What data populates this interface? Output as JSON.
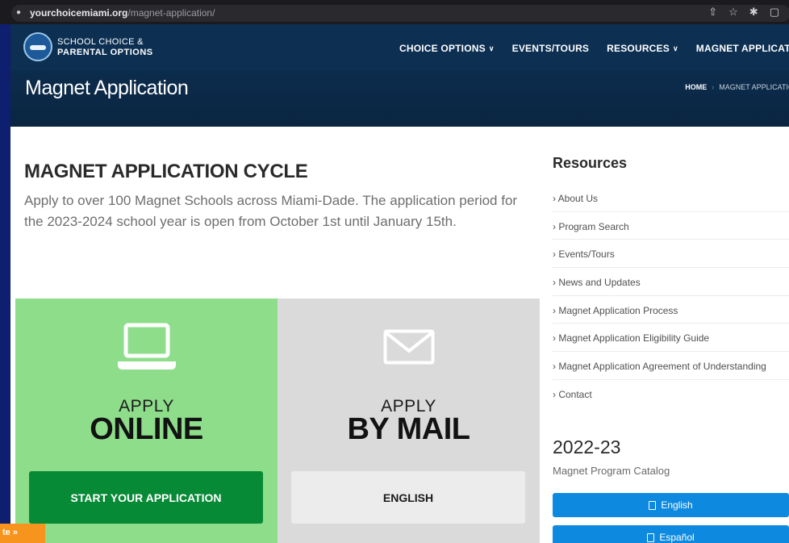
{
  "browser": {
    "url_host": "yourchoicemiami.org",
    "url_path": "/magnet-application/",
    "icons": [
      "lock-icon",
      "share-icon",
      "star-icon",
      "extensions-icon",
      "sidepanel-icon"
    ]
  },
  "header": {
    "logo_line1": "SCHOOL CHOICE &",
    "logo_line2": "PARENTAL OPTIONS",
    "nav": [
      {
        "label": "CHOICE OPTIONS",
        "dropdown": true
      },
      {
        "label": "EVENTS/TOURS",
        "dropdown": false
      },
      {
        "label": "RESOURCES",
        "dropdown": true
      },
      {
        "label": "MAGNET APPLICATION",
        "dropdown": false
      }
    ]
  },
  "title_band": {
    "title": "Magnet Application",
    "breadcrumb_home": "HOME",
    "breadcrumb_current": "MAGNET APPLICATIO"
  },
  "main": {
    "heading": "MAGNET APPLICATION CYCLE",
    "intro": "Apply to over 100 Magnet Schools across Miami-Dade. The application period for the 2023-2024 school year is open from October 1st until January 15th.",
    "online": {
      "apply": "APPLY",
      "method": "ONLINE",
      "button": "START YOUR APPLICATION",
      "color": "#8ddd8a"
    },
    "mail": {
      "apply": "APPLY",
      "method": "BY MAIL",
      "button": "ENGLISH",
      "color": "#dadada"
    },
    "translate_tab": "te »"
  },
  "sidebar": {
    "title": "Resources",
    "items": [
      "› About Us",
      "› Program Search",
      "› Events/Tours",
      "› News and Updates",
      "› Magnet Application Process",
      "› Magnet Application Eligibility Guide",
      "› Magnet Application Agreement of Understanding",
      "› Contact"
    ],
    "catalog_year": "2022-23",
    "catalog_label": "Magnet Program Catalog",
    "btn_english": "English",
    "btn_spanish": "Español",
    "button_color": "#0d8adf"
  }
}
